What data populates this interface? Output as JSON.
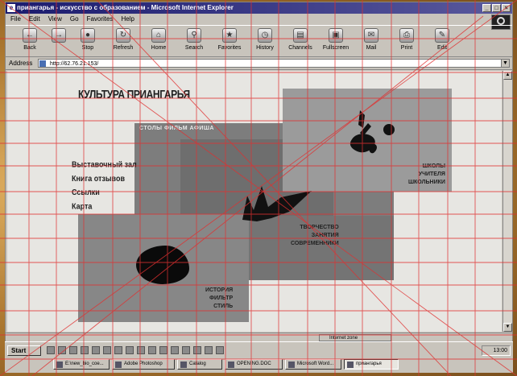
{
  "window": {
    "title": "приангарья - искусство с образованием - Microsoft Internet Explorer",
    "controls": [
      "_",
      "□",
      "×"
    ]
  },
  "menu": [
    "File",
    "Edit",
    "View",
    "Go",
    "Favorites",
    "Help"
  ],
  "toolbar": [
    {
      "label": "Back",
      "icon": "back-arrow-icon"
    },
    {
      "label": "",
      "icon": "forward-arrow-icon"
    },
    {
      "label": "Stop",
      "icon": "stop-icon"
    },
    {
      "label": "Refresh",
      "icon": "refresh-icon"
    },
    {
      "label": "Home",
      "icon": "home-icon"
    },
    {
      "label": "Search",
      "icon": "search-icon"
    },
    {
      "label": "Favorites",
      "icon": "favorites-icon"
    },
    {
      "label": "History",
      "icon": "history-icon"
    },
    {
      "label": "Channels",
      "icon": "channels-icon"
    },
    {
      "label": "Fullscreen",
      "icon": "fullscreen-icon"
    },
    {
      "label": "Mail",
      "icon": "mail-icon"
    },
    {
      "label": "Print",
      "icon": "print-icon"
    },
    {
      "label": "Edit",
      "icon": "edit-icon"
    }
  ],
  "address": {
    "label": "Address",
    "value": "http://62.76.21.153/"
  },
  "page": {
    "title": "КУЛЬТУРА ПРИАНГАРЬЯ",
    "panel_header": "СТОЛЫ  ФИЛЬМ  АФИША",
    "left_menu": [
      "Выставочный зал",
      "Книга отзывов",
      "Ссылки",
      "Карта"
    ],
    "schools_links": [
      "ШКОЛЫ",
      "УЧИТЕЛЯ",
      "ШКОЛЬНИКИ"
    ],
    "creative_links": [
      "ТВОРЧЕСТВО",
      "ЗАНЯТИЯ",
      "СОВРЕМЕННИКИ"
    ],
    "history_links": [
      "ИСТОРИЯ",
      "ФИЛЬТР",
      "СТИЛЬ"
    ]
  },
  "status": {
    "left": "",
    "zone": "Internet zone"
  },
  "taskbar": {
    "start_label": "Start",
    "tasks": [
      "E:\\new_bio_coe...",
      "Adobe Photoshop",
      "Catalog",
      "OPENING.DOC",
      "Microsoft Word...",
      "приангарья"
    ],
    "clock": "13:00"
  },
  "colors": {
    "titlebar": "#1b1b6e",
    "panel_dark": "#7d7d7d",
    "panel_light": "#9b9b9b",
    "grid": "#e03030"
  }
}
